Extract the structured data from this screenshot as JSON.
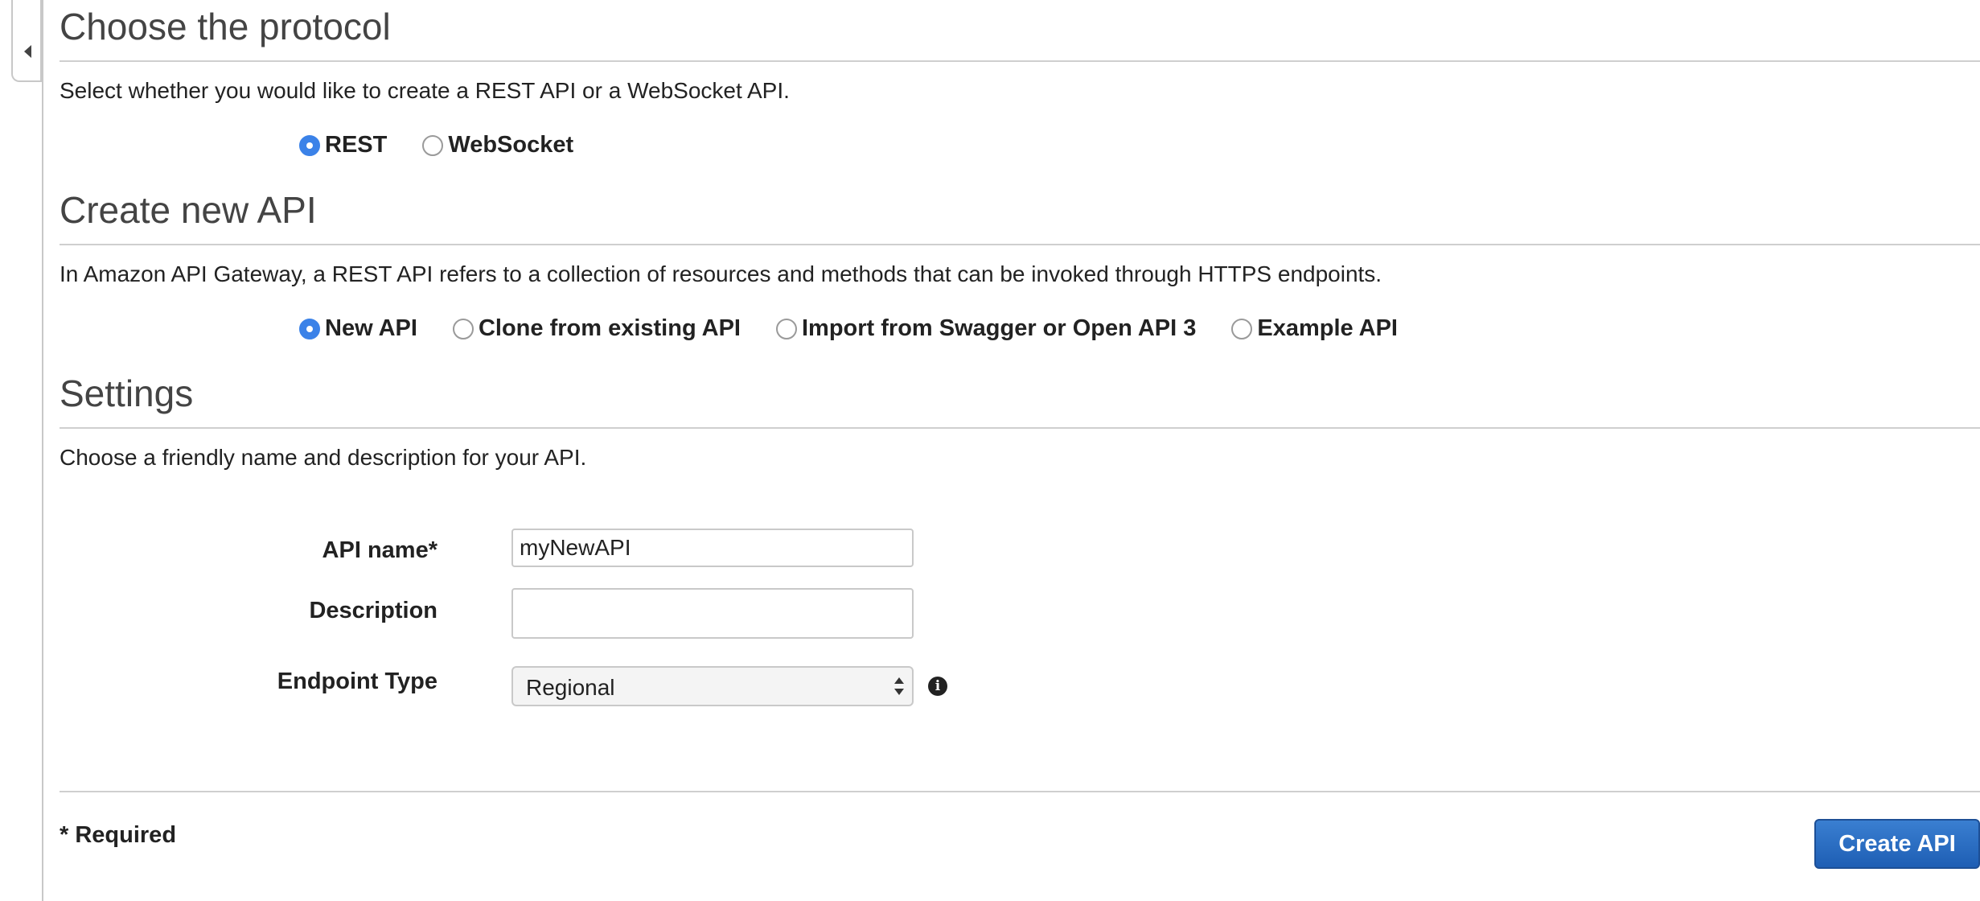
{
  "protocol": {
    "heading": "Choose the protocol",
    "description": "Select whether you would like to create a REST API or a WebSocket API.",
    "options": [
      {
        "label": "REST",
        "checked": true
      },
      {
        "label": "WebSocket",
        "checked": false
      }
    ]
  },
  "create_api": {
    "heading": "Create new API",
    "description": "In Amazon API Gateway, a REST API refers to a collection of resources and methods that can be invoked through HTTPS endpoints.",
    "options": [
      {
        "label": "New API",
        "checked": true
      },
      {
        "label": "Clone from existing API",
        "checked": false
      },
      {
        "label": "Import from Swagger or Open API 3",
        "checked": false
      },
      {
        "label": "Example API",
        "checked": false
      }
    ]
  },
  "settings": {
    "heading": "Settings",
    "description": "Choose a friendly name and description for your API.",
    "api_name_label": "API name*",
    "api_name_value": "myNewAPI",
    "description_label": "Description",
    "description_value": "",
    "endpoint_type_label": "Endpoint Type",
    "endpoint_type_value": "Regional"
  },
  "footer": {
    "required_note": "* Required",
    "create_button": "Create API"
  },
  "icons": {
    "collapse": "caret-left-icon",
    "info": "info-icon"
  },
  "colors": {
    "accent": "#3b82e8",
    "button": "#2a6cc2"
  }
}
